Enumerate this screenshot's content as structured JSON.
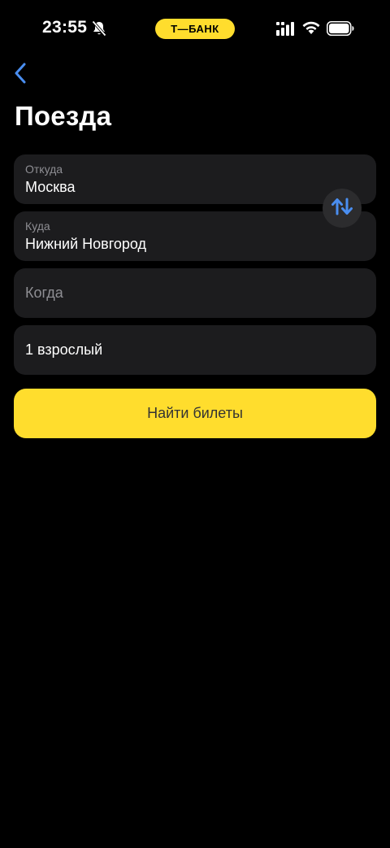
{
  "status_bar": {
    "time": "23:55",
    "brand": "Т—БАНК",
    "icons": [
      "bell-off-icon",
      "signal-icon",
      "wifi-icon",
      "battery-icon"
    ]
  },
  "header": {
    "back_icon": "chevron-left-icon",
    "title": "Поезда"
  },
  "form": {
    "from": {
      "label": "Откуда",
      "value": "Москва"
    },
    "to": {
      "label": "Куда",
      "value": "Нижний Новгород"
    },
    "when": {
      "placeholder": "Когда"
    },
    "passengers": {
      "value": "1 взрослый"
    },
    "swap_icon": "swap-vertical-icon",
    "submit_label": "Найти билеты"
  },
  "colors": {
    "background": "#000000",
    "field_background": "#1c1c1e",
    "accent_yellow": "#ffdd2d",
    "accent_blue": "#4a8ef0",
    "muted_text": "#8e8e93"
  }
}
